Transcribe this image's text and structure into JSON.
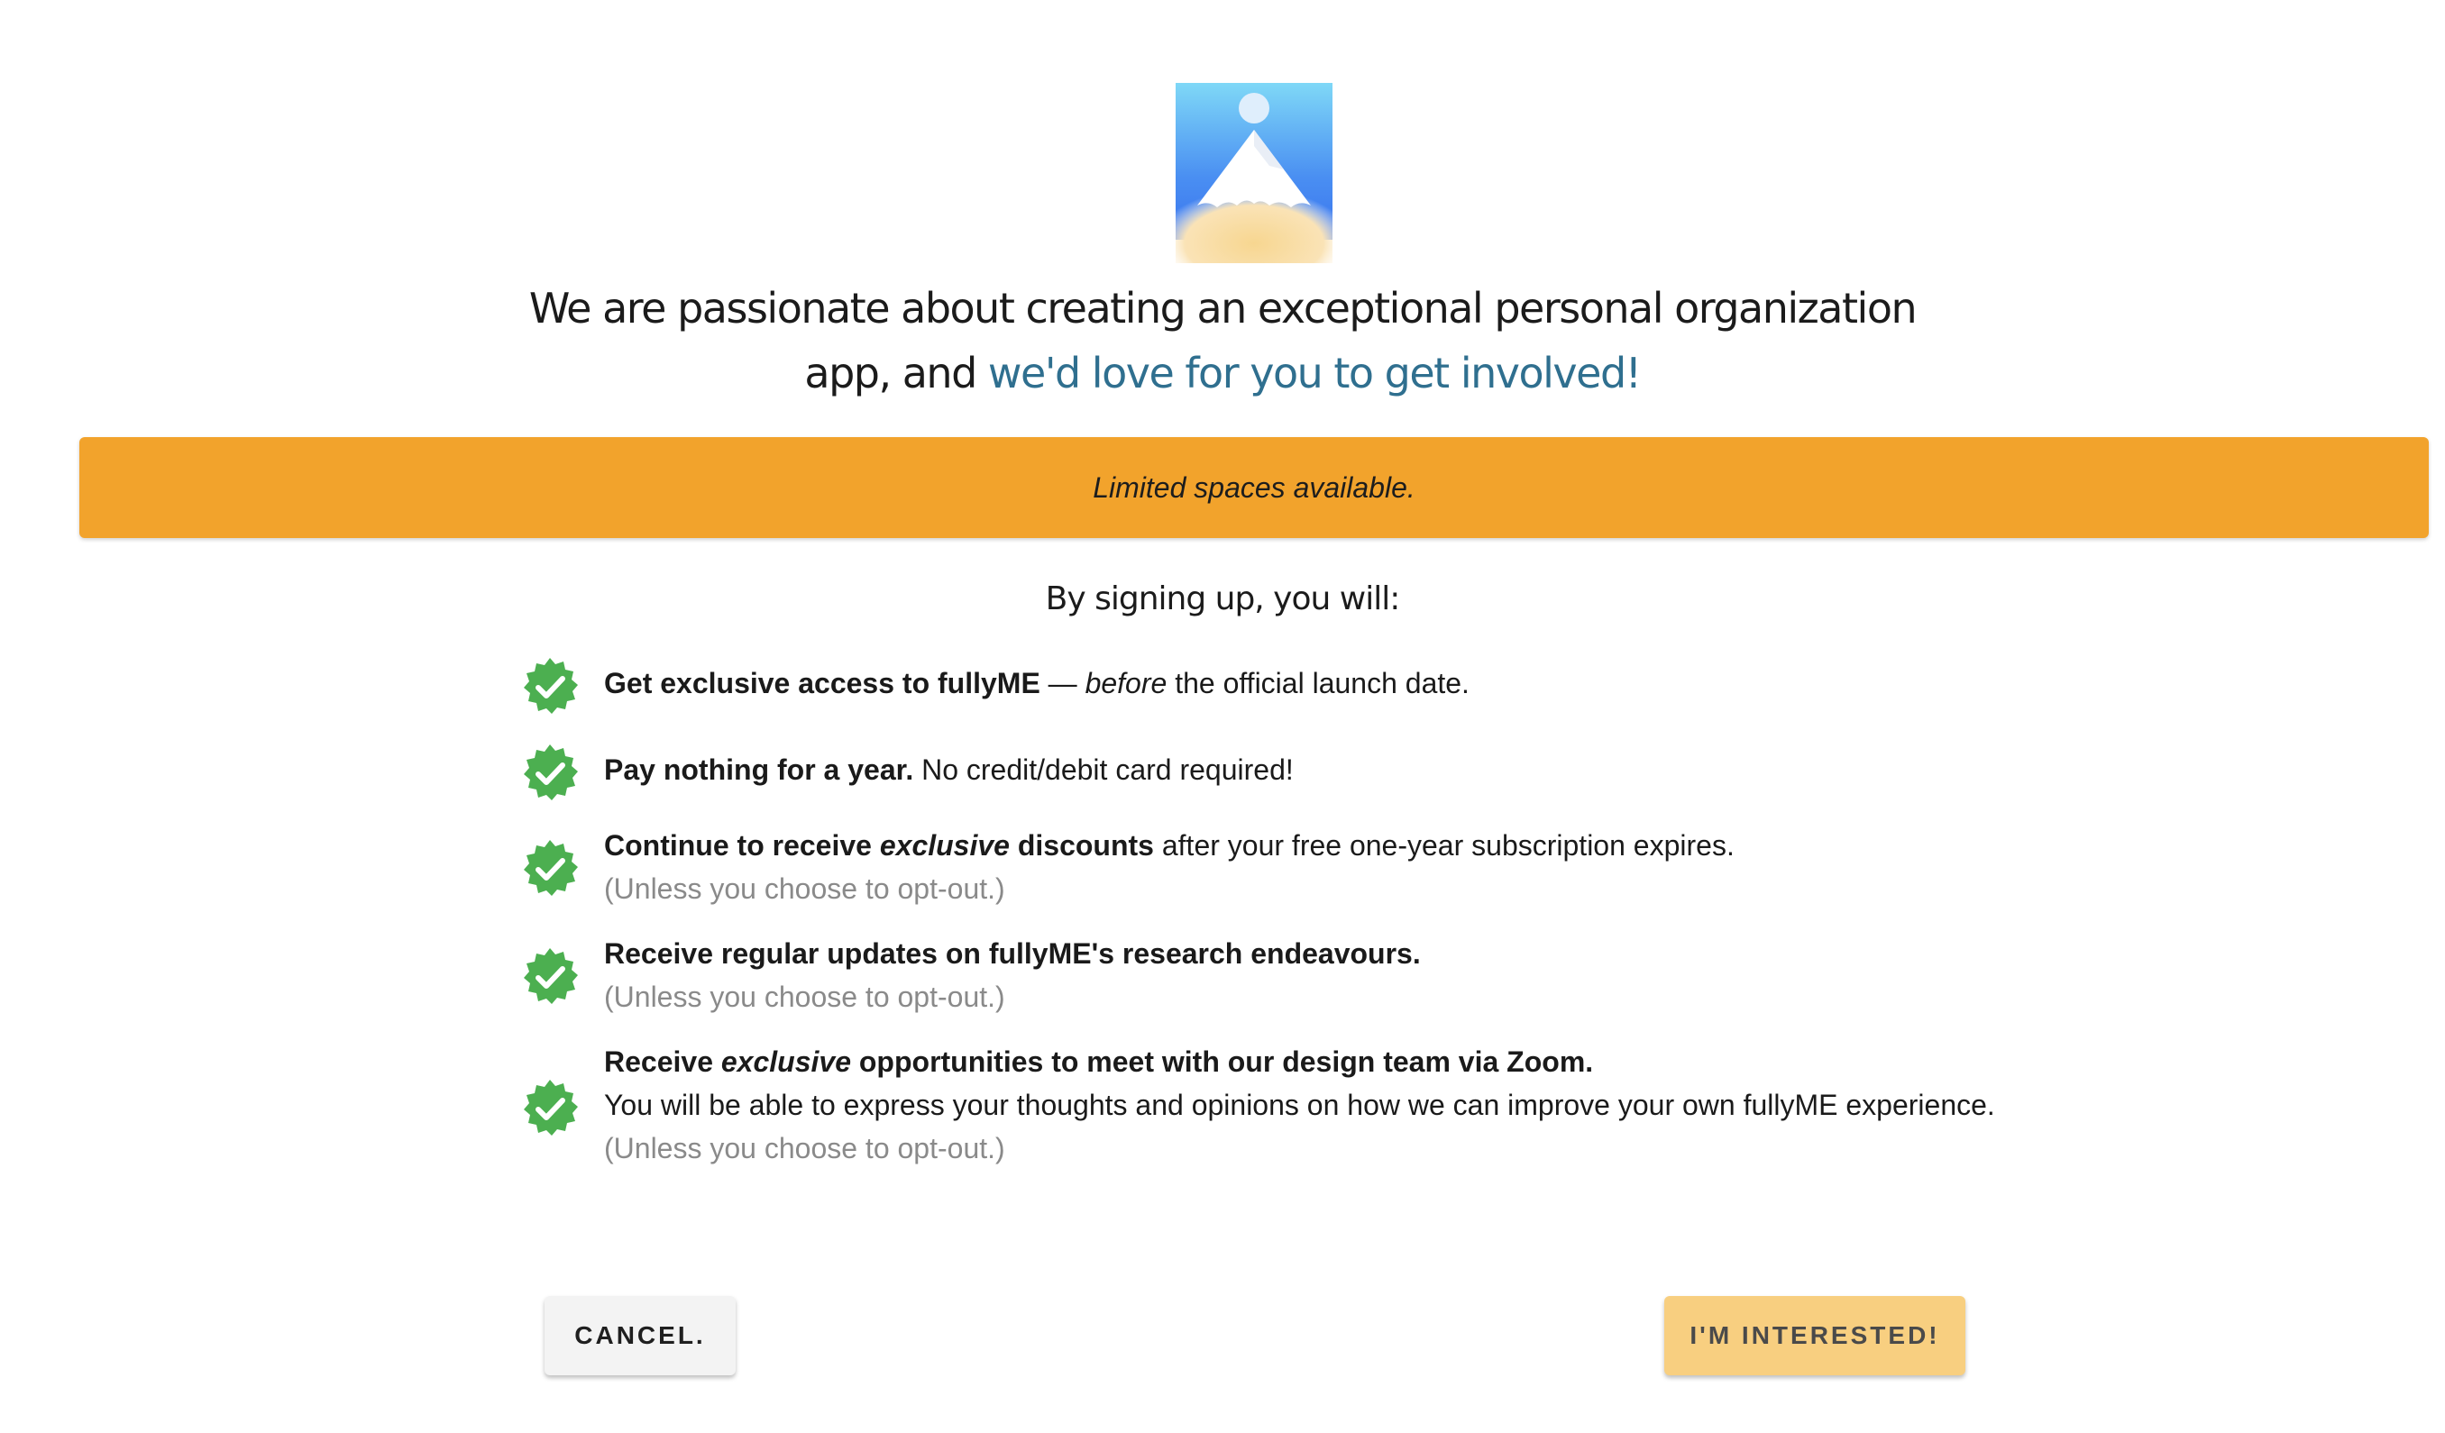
{
  "logo": {
    "icon": "mountain-logo-icon",
    "colors": {
      "sky_top": "#7fd4f5",
      "sky_bottom": "#3b7bf0",
      "glow": "#f5d39a",
      "peak": "#ffffff"
    }
  },
  "headline": {
    "part1": "We are passionate about creating an exceptional personal organization app, and ",
    "accent": "we'd love for you to get involved!"
  },
  "banner": {
    "text": "Limited spaces available.",
    "color": "#f2a32c"
  },
  "subhead": "By signing up, you will:",
  "check_icon": {
    "name": "verified-check-icon",
    "color": "#4caf50"
  },
  "benefits": [
    {
      "bold": "Get exclusive access to fullyME",
      "dash": " — ",
      "italic": "before",
      "rest": " the official launch date."
    },
    {
      "bold": "Pay nothing for a year.",
      "rest": " No credit/debit card required!"
    },
    {
      "bold1": "Continue to receive ",
      "bold_italic": "exclusive",
      "bold2": " discounts",
      "rest": " after your free one-year subscription expires.",
      "note": "(Unless you choose to opt-out.)"
    },
    {
      "bold": "Receive regular updates on fullyME's research endeavours.",
      "note": "(Unless you choose to opt-out.)"
    },
    {
      "bold1": "Receive ",
      "bold_italic": "exclusive",
      "bold2": " opportunities to meet with our design team via Zoom.",
      "line2": "You will be able to express your thoughts and opinions on how we can improve your own fullyME experience.",
      "note": "(Unless you choose to opt-out.)"
    }
  ],
  "buttons": {
    "cancel": "CANCEL.",
    "interested": "I'M INTERESTED!"
  }
}
